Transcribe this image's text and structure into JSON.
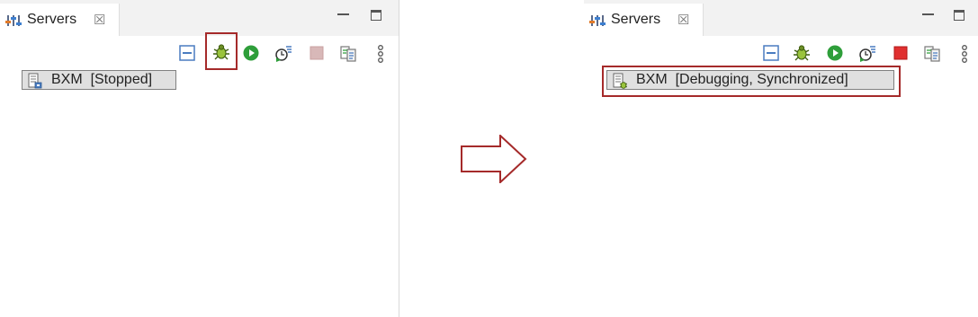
{
  "left": {
    "tab": {
      "label": "Servers",
      "close_glyph": "☒"
    },
    "server": {
      "name": "BXM",
      "status": "[Stopped]"
    }
  },
  "right": {
    "tab": {
      "label": "Servers",
      "close_glyph": "☒"
    },
    "server": {
      "name": "BXM",
      "status": "[Debugging, Synchronized]"
    }
  },
  "icons": {
    "tab": "servers-view-icon",
    "toolbar": [
      "collapse-all-icon",
      "debug-bug-icon",
      "start-server-icon",
      "profile-server-icon",
      "stop-server-icon",
      "publish-icon",
      "view-menu-icon"
    ],
    "arrow": "right-arrow-icon"
  },
  "colors": {
    "highlight": "#a52a2a",
    "start_green": "#2e9e3a",
    "stop_red": "#e03030",
    "stop_disabled": "#c8a0a0"
  }
}
